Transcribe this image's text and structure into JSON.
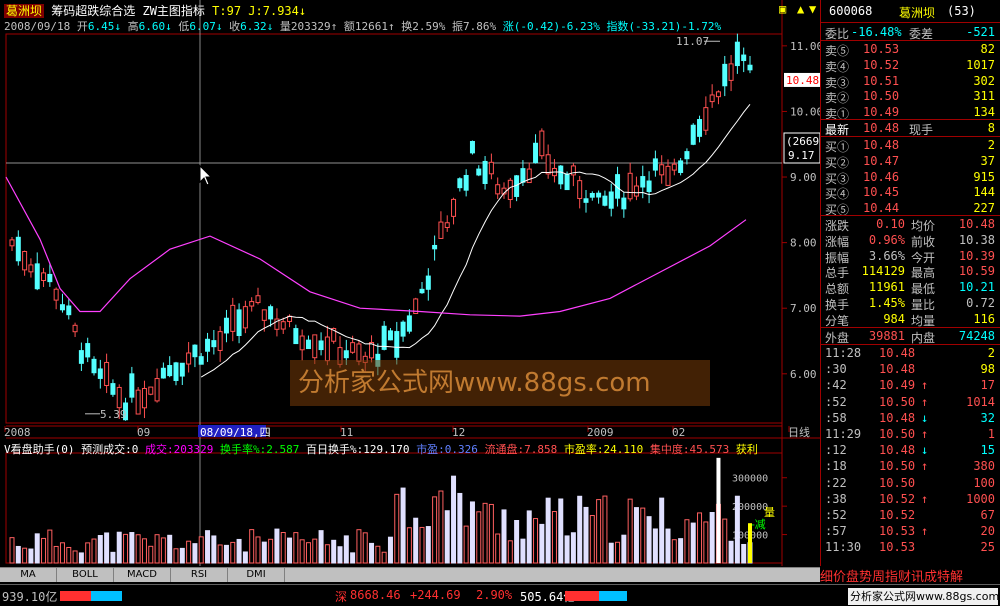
{
  "window": {
    "stock_name": "葛洲坝",
    "indicator_title": "筹码超跌综合选 ZW主图指标",
    "indicator_vals": "T:97  J:7.934↓"
  },
  "quote_line": {
    "date": "2008/09/18",
    "open_lbl": "开",
    "open": "6.45↓",
    "high_lbl": "高",
    "high": "6.60↓",
    "low_lbl": "低",
    "low": "6.07↓",
    "close_lbl": "收",
    "close": "6.32↓",
    "vol_lbl": "量",
    "vol": "203329↑",
    "amt_lbl": "额",
    "amt": "12661↑",
    "turn_lbl": "换",
    "turn": "2.59%",
    "amp_lbl": "振",
    "amp": "7.86%",
    "chg_lbl": "涨",
    "chg": "(-0.42)-6.23%",
    "idx_lbl": "指数",
    "idx": "(-33.21)-1.72%"
  },
  "chart_data": {
    "type": "candlestick",
    "y_axis_ticks": [
      "11.00",
      "10.00",
      "9.00",
      "8.00",
      "7.00",
      "6.00"
    ],
    "ylim": [
      5.25,
      11.15
    ],
    "x_axis_ticks": [
      "2008",
      "09",
      "08/09/18,四",
      "11",
      "12",
      "2009",
      "02",
      "日线"
    ],
    "annotations": {
      "high": "11.07",
      "low": "5.39"
    },
    "price_tag": "10.48",
    "cursor_box": [
      "(2669)",
      "9.17"
    ],
    "volume_panel": {
      "title": "V看盘助手(0) 预测成交:0",
      "items": [
        {
          "label": "成交:203329",
          "color": "#ff00ff"
        },
        {
          "label": "换手率%:2.587",
          "color": "#00ff00"
        },
        {
          "label": "百日换手%:129.170",
          "color": "#ffffff"
        },
        {
          "label": "市盈:0.326",
          "color": "#6080ff"
        },
        {
          "label": "流通盘:7.858",
          "color": "#ff5050"
        },
        {
          "label": "市盈率:24.110",
          "color": "#ffff00"
        },
        {
          "label": "集中度:45.573",
          "color": "#ff5050"
        },
        {
          "label": "获利",
          "color": "#ffff00"
        }
      ],
      "y_ticks": [
        "300000",
        "200000",
        "100000"
      ],
      "side_note_1": "量",
      "side_note_2": "←减"
    }
  },
  "panel": {
    "code": "600068",
    "name": "葛洲坝",
    "num": "(53)",
    "webi_lbl": "委比",
    "webi": "-16.48%",
    "wecha_lbl": "委差",
    "wecha": "-521",
    "asks": [
      {
        "lbl": "卖⑤",
        "p": "10.53",
        "v": "82"
      },
      {
        "lbl": "卖④",
        "p": "10.52",
        "v": "1017"
      },
      {
        "lbl": "卖③",
        "p": "10.51",
        "v": "302"
      },
      {
        "lbl": "卖②",
        "p": "10.50",
        "v": "311"
      },
      {
        "lbl": "卖①",
        "p": "10.49",
        "v": "134"
      }
    ],
    "last_lbl": "最新",
    "last": "10.48",
    "cur_lbl": "现手",
    "cur": "8",
    "bids": [
      {
        "lbl": "买①",
        "p": "10.48",
        "v": "2"
      },
      {
        "lbl": "买②",
        "p": "10.47",
        "v": "37"
      },
      {
        "lbl": "买③",
        "p": "10.46",
        "v": "915"
      },
      {
        "lbl": "买④",
        "p": "10.45",
        "v": "144"
      },
      {
        "lbl": "买⑤",
        "p": "10.44",
        "v": "227"
      }
    ],
    "stats": [
      {
        "l1": "涨跌",
        "v1": "0.10",
        "l2": "均价",
        "v2": "10.48",
        "c1": "#ff5050",
        "c2": "#ff5050"
      },
      {
        "l1": "涨幅",
        "v1": "0.96%",
        "l2": "前收",
        "v2": "10.38",
        "c1": "#ff5050",
        "c2": "#c0c0c0"
      },
      {
        "l1": "振幅",
        "v1": "3.66%",
        "l2": "今开",
        "v2": "10.39",
        "c1": "#c0c0c0",
        "c2": "#ff5050"
      },
      {
        "l1": "总手",
        "v1": "114129",
        "l2": "最高",
        "v2": "10.59",
        "c1": "#ffff00",
        "c2": "#ff5050"
      },
      {
        "l1": "总额",
        "v1": "11961",
        "l2": "最低",
        "v2": "10.21",
        "c1": "#ffff00",
        "c2": "#00ffff"
      },
      {
        "l1": "换手",
        "v1": "1.45%",
        "l2": "量比",
        "v2": "0.72",
        "c1": "#ffff00",
        "c2": "#c0c0c0"
      },
      {
        "l1": "分笔",
        "v1": "984",
        "l2": "均量",
        "v2": "116",
        "c1": "#ffff00",
        "c2": "#ffff00"
      }
    ],
    "outer_lbl": "外盘",
    "outer": "39881",
    "inner_lbl": "内盘",
    "inner": "74248",
    "ticks": [
      {
        "t": "11:28",
        "p": "10.48",
        "a": "",
        "v": "2",
        "pc": "#ff5050",
        "vc": "#ffff00"
      },
      {
        "t": ":30",
        "p": "10.48",
        "a": "",
        "v": "98",
        "pc": "#ff5050",
        "vc": "#ffff00"
      },
      {
        "t": ":42",
        "p": "10.49",
        "a": "↑",
        "v": "17",
        "pc": "#ff5050",
        "vc": "#ff5050"
      },
      {
        "t": ":52",
        "p": "10.50",
        "a": "↑",
        "v": "1014",
        "pc": "#ff5050",
        "vc": "#ff5050"
      },
      {
        "t": ":58",
        "p": "10.48",
        "a": "↓",
        "v": "32",
        "pc": "#ff5050",
        "vc": "#00ffff"
      },
      {
        "t": "11:29",
        "p": "10.50",
        "a": "↑",
        "v": "1",
        "pc": "#ff5050",
        "vc": "#ff5050"
      },
      {
        "t": ":12",
        "p": "10.48",
        "a": "↓",
        "v": "15",
        "pc": "#ff5050",
        "vc": "#00ffff"
      },
      {
        "t": ":18",
        "p": "10.50",
        "a": "↑",
        "v": "380",
        "pc": "#ff5050",
        "vc": "#ff5050"
      },
      {
        "t": ":22",
        "p": "10.50",
        "a": "",
        "v": "100",
        "pc": "#ff5050",
        "vc": "#ff5050"
      },
      {
        "t": ":38",
        "p": "10.52",
        "a": "↑",
        "v": "1000",
        "pc": "#ff5050",
        "vc": "#ff5050"
      },
      {
        "t": ":52",
        "p": "10.52",
        "a": "",
        "v": "67",
        "pc": "#ff5050",
        "vc": "#ff5050"
      },
      {
        "t": ":57",
        "p": "10.53",
        "a": "↑",
        "v": "20",
        "pc": "#ff5050",
        "vc": "#ff5050"
      },
      {
        "t": "11:30",
        "p": "10.53",
        "a": "",
        "v": "25",
        "pc": "#ff5050",
        "vc": "#ff5050"
      }
    ]
  },
  "tabs": [
    "MA",
    "BOLL",
    "MACD",
    "RSI",
    "DMI"
  ],
  "ticker_text": "细价盘势周指财讯成特解",
  "status": {
    "left_val": "939.10亿",
    "mkt": "深",
    "index": "8668.46",
    "change": "+244.69",
    "pct": "2.90%",
    "amount": "505.64亿"
  },
  "watermark": "分析家公式网www.88gs.com",
  "watermark2": "分析家公式网www.88gs.com"
}
